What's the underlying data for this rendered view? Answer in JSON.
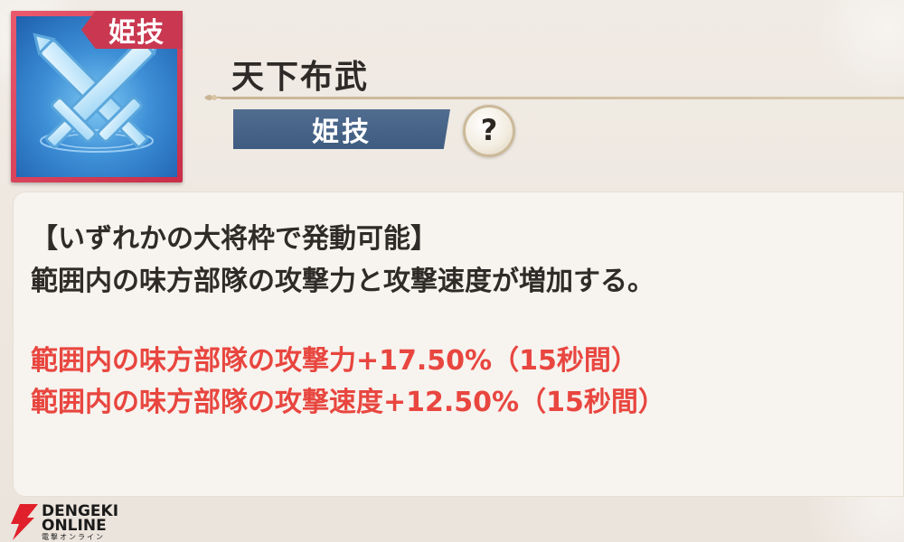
{
  "skill": {
    "icon_badge": "姫技",
    "title": "天下布武",
    "type_label": "姫技",
    "help_symbol": "?"
  },
  "description": {
    "condition": "【いずれかの大将枠で発動可能】",
    "summary": "範囲内の味方部隊の攻撃力と攻撃速度が増加する。",
    "effects": [
      "範囲内の味方部隊の攻撃力+17.50%（15秒間）",
      "範囲内の味方部隊の攻撃速度+12.50%（15秒間）"
    ]
  },
  "watermark": {
    "line1": "DENGEKI",
    "line2": "ONLINE",
    "line3": "電撃オンライン"
  },
  "colors": {
    "effect_text": "#e8463f",
    "body_text": "#2f2b28",
    "type_label_bg": "#46648a",
    "icon_frame": "#c93850"
  }
}
